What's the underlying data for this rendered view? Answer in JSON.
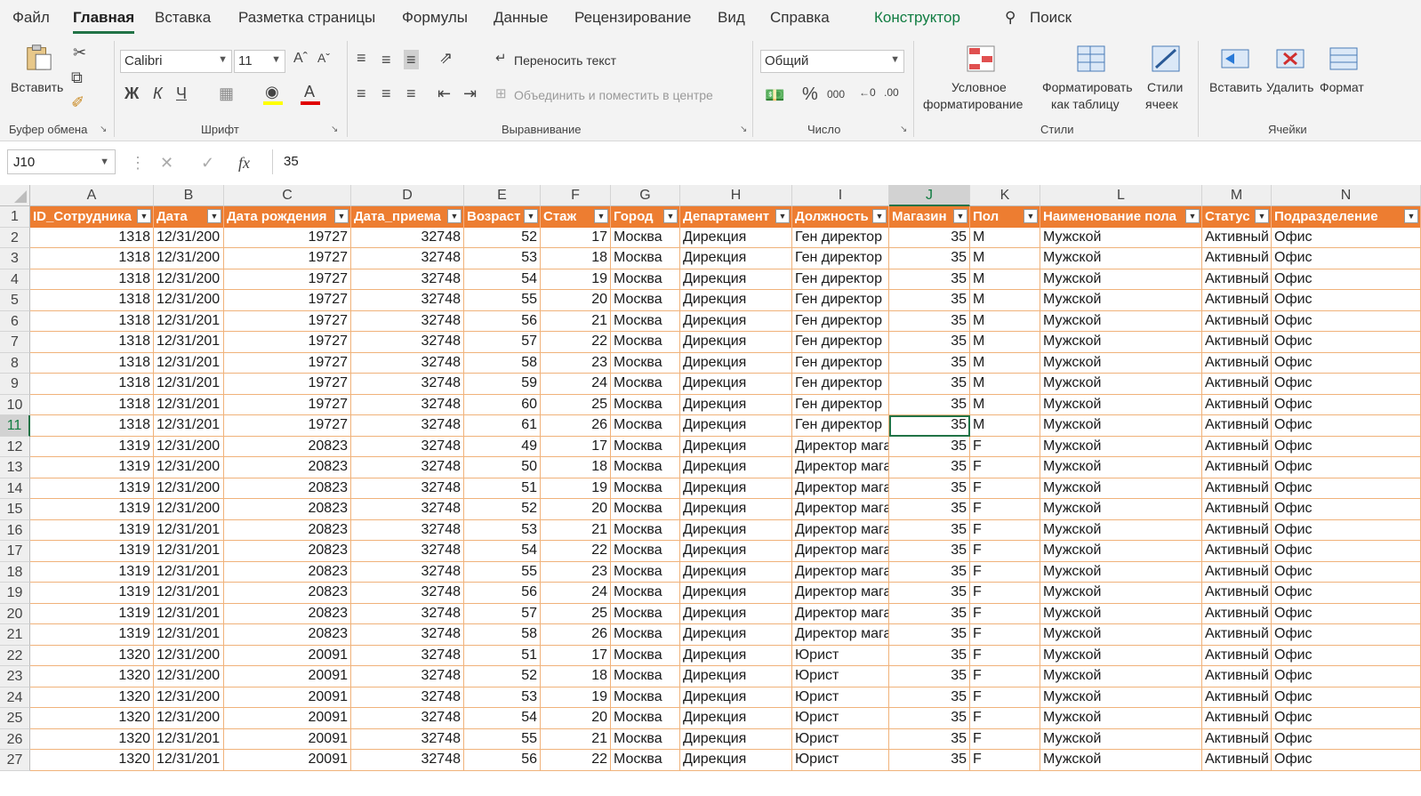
{
  "menu": {
    "file": "Файл",
    "home": "Главная",
    "insert": "Вставка",
    "page_layout": "Разметка страницы",
    "formulas": "Формулы",
    "data": "Данные",
    "review": "Рецензирование",
    "view": "Вид",
    "help": "Справка",
    "design": "Конструктор",
    "search": "Поиск"
  },
  "ribbon": {
    "clipboard": {
      "paste": "Вставить",
      "label": "Буфер обмена"
    },
    "font": {
      "name": "Calibri",
      "size": "11",
      "bold": "Ж",
      "italic": "К",
      "underline": "Ч",
      "label": "Шрифт"
    },
    "alignment": {
      "wrap": "Переносить текст",
      "merge": "Объединить и поместить в центре",
      "label": "Выравнивание"
    },
    "number": {
      "format": "Общий",
      "percent": "%",
      "thousands": "000",
      "label": "Число"
    },
    "styles": {
      "cond_line1": "Условное",
      "cond_line2": "форматирование",
      "table_line1": "Форматировать",
      "table_line2": "как таблицу",
      "cell_line1": "Стили",
      "cell_line2": "ячеек",
      "label": "Стили"
    },
    "cells": {
      "insert": "Вставить",
      "delete": "Удалить",
      "format": "Формат",
      "label": "Ячейки"
    }
  },
  "formula_bar": {
    "name_box": "J10",
    "fx": "fx",
    "value": "35"
  },
  "colors": {
    "accent": "#217346",
    "header_fill": "#ed7d31",
    "border": "#f0b27a"
  },
  "columns": [
    "A",
    "B",
    "C",
    "D",
    "E",
    "F",
    "G",
    "H",
    "I",
    "J",
    "K",
    "L",
    "M",
    "N"
  ],
  "headers": [
    "ID_Сотрудника",
    "Дата",
    "Дата рождения",
    "Дата_приема",
    "Возраст",
    "Стаж",
    "Город",
    "Департамент",
    "Должность",
    "Магазин",
    "Пол",
    "Наименование пола",
    "Статус",
    "Подразделение"
  ],
  "row_numbers": [
    "1",
    "2",
    "3",
    "4",
    "5",
    "6",
    "7",
    "8",
    "9",
    "10",
    "11",
    "12",
    "13",
    "14",
    "15",
    "16",
    "17",
    "18",
    "19",
    "20",
    "21",
    "22",
    "23",
    "24",
    "25",
    "26",
    "27"
  ],
  "rows": [
    [
      "1318",
      "12/31/200",
      "19727",
      "32748",
      "52",
      "17",
      "Москва",
      "Дирекция",
      "Ген директор",
      "35",
      "M",
      "Мужской",
      "Активный",
      "Офис"
    ],
    [
      "1318",
      "12/31/200",
      "19727",
      "32748",
      "53",
      "18",
      "Москва",
      "Дирекция",
      "Ген директор",
      "35",
      "M",
      "Мужской",
      "Активный",
      "Офис"
    ],
    [
      "1318",
      "12/31/200",
      "19727",
      "32748",
      "54",
      "19",
      "Москва",
      "Дирекция",
      "Ген директор",
      "35",
      "M",
      "Мужской",
      "Активный",
      "Офис"
    ],
    [
      "1318",
      "12/31/200",
      "19727",
      "32748",
      "55",
      "20",
      "Москва",
      "Дирекция",
      "Ген директор",
      "35",
      "M",
      "Мужской",
      "Активный",
      "Офис"
    ],
    [
      "1318",
      "12/31/201",
      "19727",
      "32748",
      "56",
      "21",
      "Москва",
      "Дирекция",
      "Ген директор",
      "35",
      "M",
      "Мужской",
      "Активный",
      "Офис"
    ],
    [
      "1318",
      "12/31/201",
      "19727",
      "32748",
      "57",
      "22",
      "Москва",
      "Дирекция",
      "Ген директор",
      "35",
      "M",
      "Мужской",
      "Активный",
      "Офис"
    ],
    [
      "1318",
      "12/31/201",
      "19727",
      "32748",
      "58",
      "23",
      "Москва",
      "Дирекция",
      "Ген директор",
      "35",
      "M",
      "Мужской",
      "Активный",
      "Офис"
    ],
    [
      "1318",
      "12/31/201",
      "19727",
      "32748",
      "59",
      "24",
      "Москва",
      "Дирекция",
      "Ген директор",
      "35",
      "M",
      "Мужской",
      "Активный",
      "Офис"
    ],
    [
      "1318",
      "12/31/201",
      "19727",
      "32748",
      "60",
      "25",
      "Москва",
      "Дирекция",
      "Ген директор",
      "35",
      "M",
      "Мужской",
      "Активный",
      "Офис"
    ],
    [
      "1318",
      "12/31/201",
      "19727",
      "32748",
      "61",
      "26",
      "Москва",
      "Дирекция",
      "Ген директор",
      "35",
      "M",
      "Мужской",
      "Активный",
      "Офис"
    ],
    [
      "1319",
      "12/31/200",
      "20823",
      "32748",
      "49",
      "17",
      "Москва",
      "Дирекция",
      "Директор мага",
      "35",
      "F",
      "Мужской",
      "Активный",
      "Офис"
    ],
    [
      "1319",
      "12/31/200",
      "20823",
      "32748",
      "50",
      "18",
      "Москва",
      "Дирекция",
      "Директор мага",
      "35",
      "F",
      "Мужской",
      "Активный",
      "Офис"
    ],
    [
      "1319",
      "12/31/200",
      "20823",
      "32748",
      "51",
      "19",
      "Москва",
      "Дирекция",
      "Директор мага",
      "35",
      "F",
      "Мужской",
      "Активный",
      "Офис"
    ],
    [
      "1319",
      "12/31/200",
      "20823",
      "32748",
      "52",
      "20",
      "Москва",
      "Дирекция",
      "Директор мага",
      "35",
      "F",
      "Мужской",
      "Активный",
      "Офис"
    ],
    [
      "1319",
      "12/31/201",
      "20823",
      "32748",
      "53",
      "21",
      "Москва",
      "Дирекция",
      "Директор мага",
      "35",
      "F",
      "Мужской",
      "Активный",
      "Офис"
    ],
    [
      "1319",
      "12/31/201",
      "20823",
      "32748",
      "54",
      "22",
      "Москва",
      "Дирекция",
      "Директор мага",
      "35",
      "F",
      "Мужской",
      "Активный",
      "Офис"
    ],
    [
      "1319",
      "12/31/201",
      "20823",
      "32748",
      "55",
      "23",
      "Москва",
      "Дирекция",
      "Директор мага",
      "35",
      "F",
      "Мужской",
      "Активный",
      "Офис"
    ],
    [
      "1319",
      "12/31/201",
      "20823",
      "32748",
      "56",
      "24",
      "Москва",
      "Дирекция",
      "Директор мага",
      "35",
      "F",
      "Мужской",
      "Активный",
      "Офис"
    ],
    [
      "1319",
      "12/31/201",
      "20823",
      "32748",
      "57",
      "25",
      "Москва",
      "Дирекция",
      "Директор мага",
      "35",
      "F",
      "Мужской",
      "Активный",
      "Офис"
    ],
    [
      "1319",
      "12/31/201",
      "20823",
      "32748",
      "58",
      "26",
      "Москва",
      "Дирекция",
      "Директор мага",
      "35",
      "F",
      "Мужской",
      "Активный",
      "Офис"
    ],
    [
      "1320",
      "12/31/200",
      "20091",
      "32748",
      "51",
      "17",
      "Москва",
      "Дирекция",
      "Юрист",
      "35",
      "F",
      "Мужской",
      "Активный",
      "Офис"
    ],
    [
      "1320",
      "12/31/200",
      "20091",
      "32748",
      "52",
      "18",
      "Москва",
      "Дирекция",
      "Юрист",
      "35",
      "F",
      "Мужской",
      "Активный",
      "Офис"
    ],
    [
      "1320",
      "12/31/200",
      "20091",
      "32748",
      "53",
      "19",
      "Москва",
      "Дирекция",
      "Юрист",
      "35",
      "F",
      "Мужской",
      "Активный",
      "Офис"
    ],
    [
      "1320",
      "12/31/200",
      "20091",
      "32748",
      "54",
      "20",
      "Москва",
      "Дирекция",
      "Юрист",
      "35",
      "F",
      "Мужской",
      "Активный",
      "Офис"
    ],
    [
      "1320",
      "12/31/201",
      "20091",
      "32748",
      "55",
      "21",
      "Москва",
      "Дирекция",
      "Юрист",
      "35",
      "F",
      "Мужской",
      "Активный",
      "Офис"
    ],
    [
      "1320",
      "12/31/201",
      "20091",
      "32748",
      "56",
      "22",
      "Москва",
      "Дирекция",
      "Юрист",
      "35",
      "F",
      "Мужской",
      "Активный",
      "Офис"
    ]
  ],
  "active": {
    "row": 9,
    "col": 9
  }
}
